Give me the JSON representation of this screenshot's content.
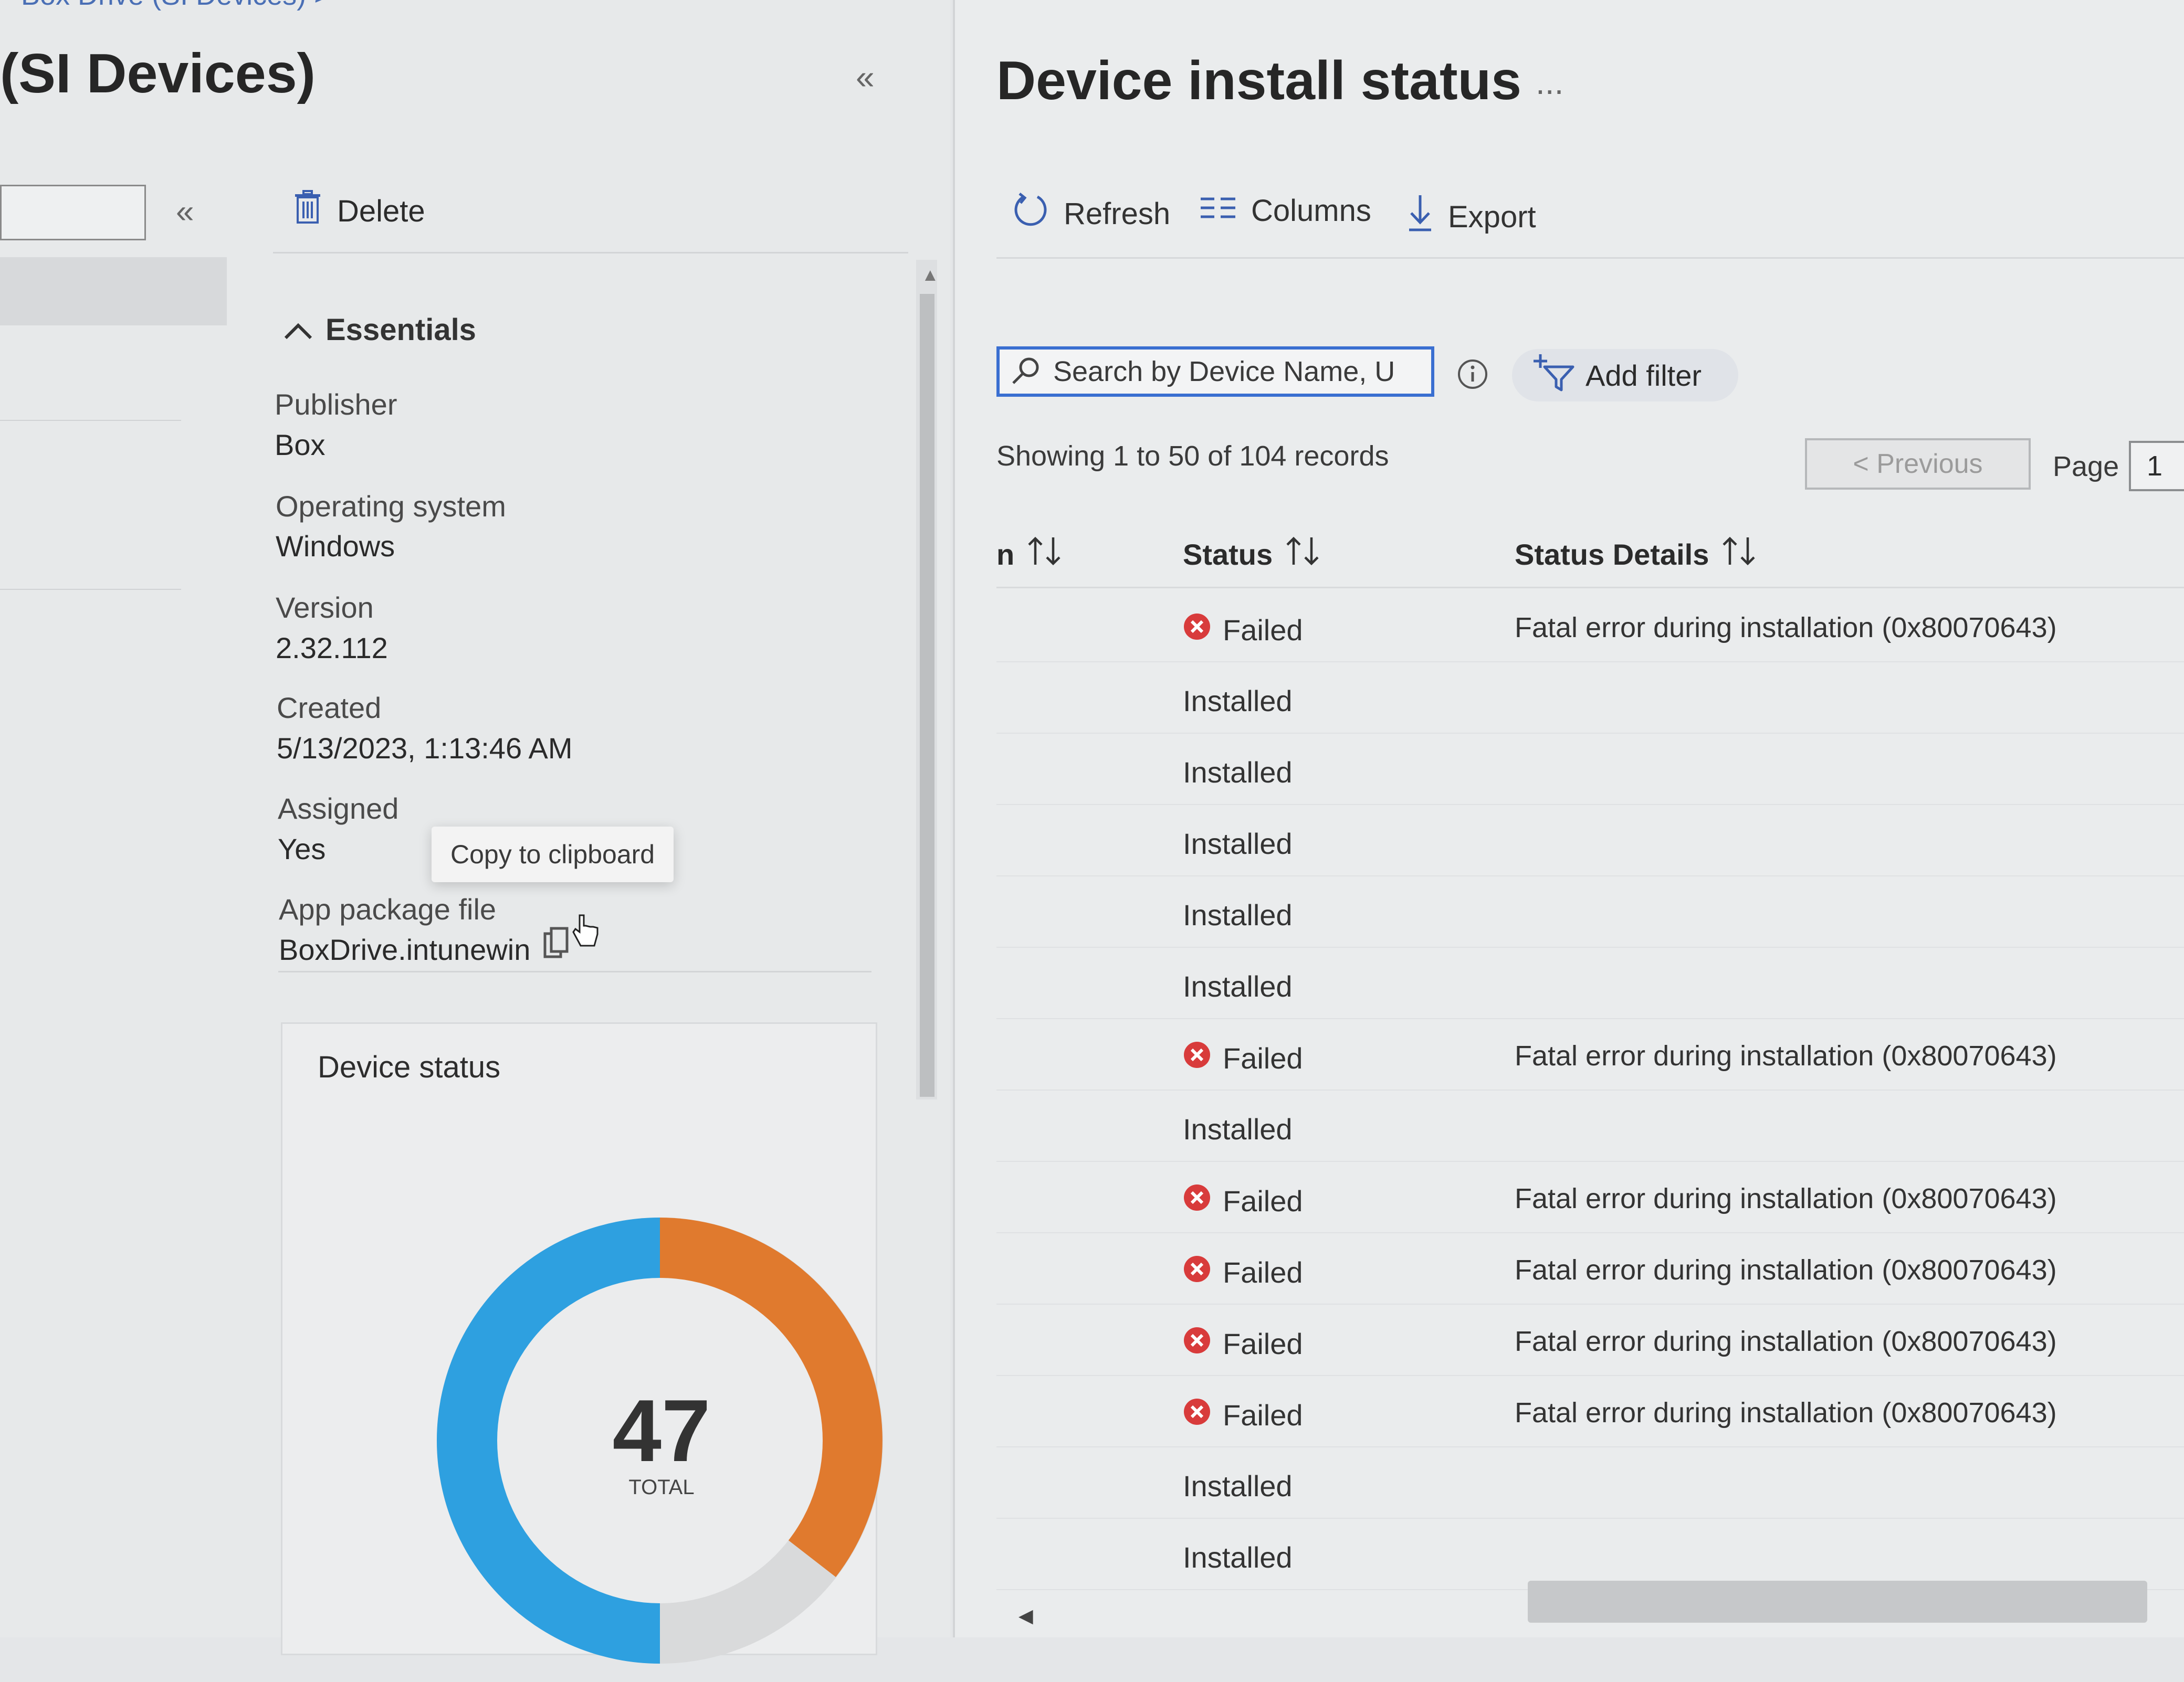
{
  "breadcrumb": "Box Drive (SI Devices) >",
  "left_blade": {
    "title": "(SI Devices)",
    "collapse_glyph": "«",
    "toolbar": {
      "delete_label": "Delete"
    },
    "essentials": {
      "heading": "Essentials",
      "properties": [
        {
          "label": "Publisher",
          "value": "Box"
        },
        {
          "label": "Operating system",
          "value": "Windows"
        },
        {
          "label": "Version",
          "value": "2.32.112"
        },
        {
          "label": "Created",
          "value": "5/13/2023, 1:13:46 AM"
        },
        {
          "label": "Assigned",
          "value": "Yes"
        },
        {
          "label": "App package file",
          "value": "BoxDrive.intunewin"
        }
      ],
      "tooltip": "Copy to clipboard"
    },
    "device_status": {
      "title": "Device status",
      "total": "47",
      "total_label": "TOTAL"
    }
  },
  "right_blade": {
    "title": "Device install status",
    "more": "...",
    "toolbar": {
      "refresh": "Refresh",
      "columns": "Columns",
      "export": "Export"
    },
    "search": {
      "placeholder": "Search by Device Name, U"
    },
    "add_filter": "Add filter",
    "records": "Showing 1 to 50 of 104 records",
    "pagination": {
      "previous": "< Previous",
      "page_label": "Page",
      "page": "1"
    },
    "columns": {
      "device": "n",
      "status": "Status",
      "details": "Status Details"
    },
    "rows": [
      {
        "status": "Failed",
        "details": "Fatal error during installation (0x80070643)"
      },
      {
        "status": "Installed",
        "details": ""
      },
      {
        "status": "Installed",
        "details": ""
      },
      {
        "status": "Installed",
        "details": ""
      },
      {
        "status": "Installed",
        "details": ""
      },
      {
        "status": "Installed",
        "details": ""
      },
      {
        "status": "Failed",
        "details": "Fatal error during installation (0x80070643)"
      },
      {
        "status": "Installed",
        "details": ""
      },
      {
        "status": "Failed",
        "details": "Fatal error during installation (0x80070643)"
      },
      {
        "status": "Failed",
        "details": "Fatal error during installation (0x80070643)"
      },
      {
        "status": "Failed",
        "details": "Fatal error during installation (0x80070643)"
      },
      {
        "status": "Failed",
        "details": "Fatal error during installation (0x80070643)"
      },
      {
        "status": "Installed",
        "details": ""
      },
      {
        "status": "Installed",
        "details": ""
      }
    ]
  },
  "icons": {
    "delete": "trash-icon",
    "refresh": "refresh-icon",
    "columns": "columns-icon",
    "export": "download-icon",
    "search": "search-icon",
    "info": "info-icon",
    "filter": "add-filter-icon",
    "failed": "error-circle-icon",
    "copy": "copy-icon"
  },
  "colors": {
    "accent": "#3a6fd1",
    "failed": "#d83b3b",
    "donut_installed": "#2ea0e0",
    "donut_failed": "#e07a2e"
  }
}
